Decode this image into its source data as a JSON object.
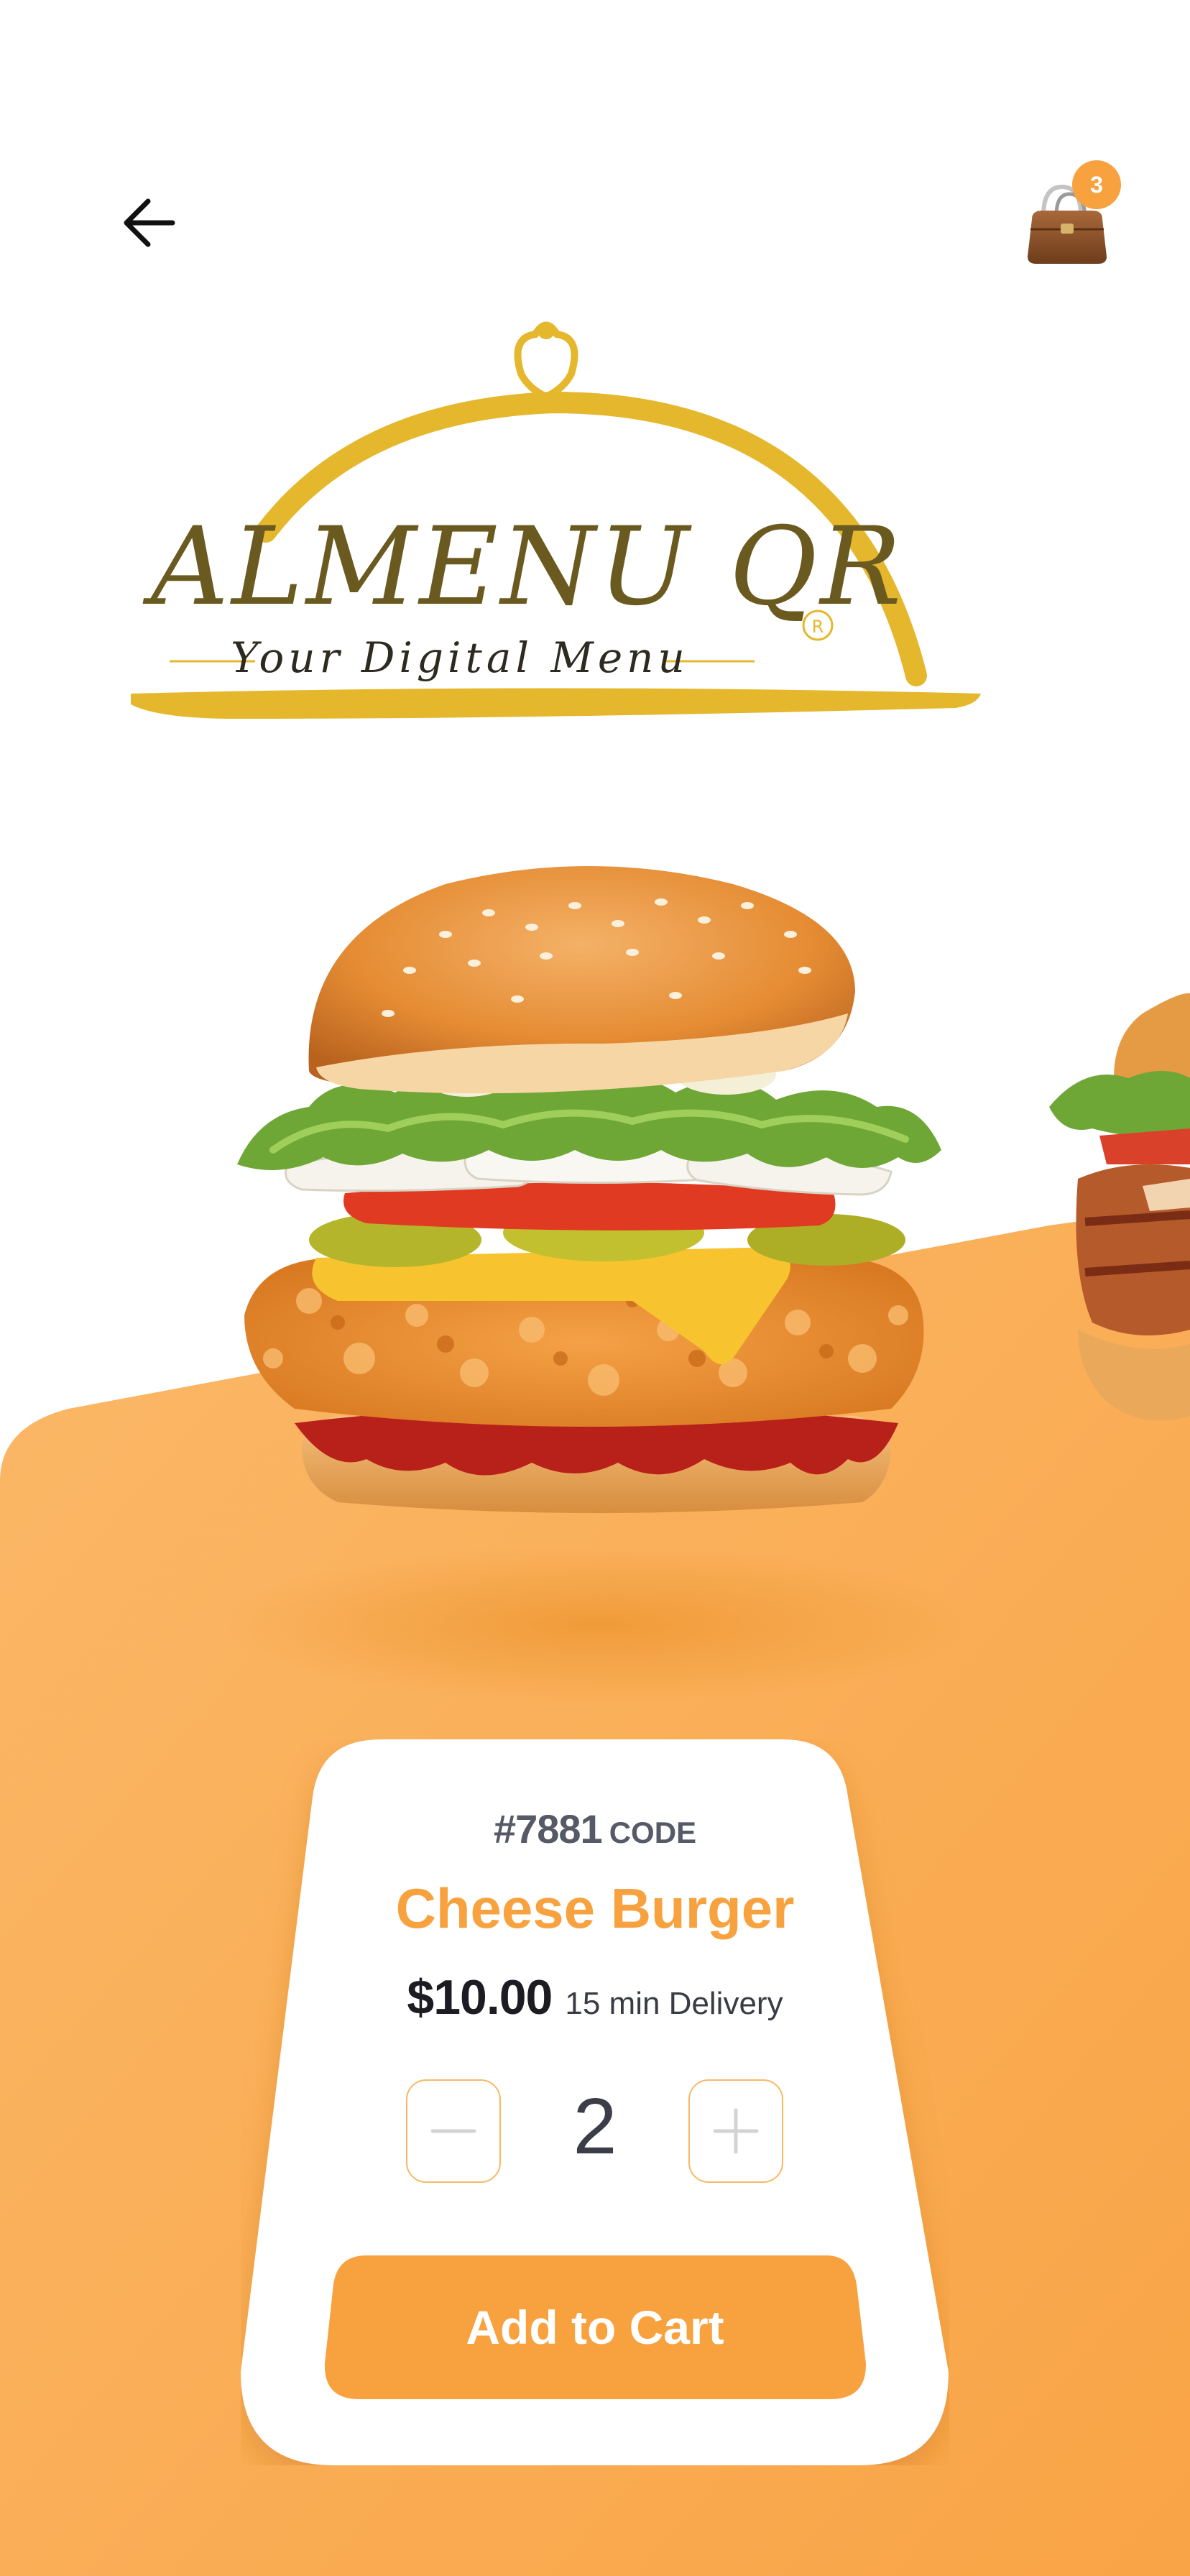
{
  "header": {
    "back_icon": "arrow-left-icon",
    "cart_icon": "shopping-bag-icon",
    "cart_count": "3"
  },
  "logo": {
    "brand": "ALMENU QR",
    "tagline": "Your Digital Menu",
    "registered": "R"
  },
  "product": {
    "code_number": "#7881",
    "code_label": "CODE",
    "name": "Cheese Burger",
    "price": "$10.00",
    "delivery": "15 min Delivery",
    "quantity": "2"
  },
  "actions": {
    "decrease_icon": "minus-icon",
    "increase_icon": "plus-icon",
    "add_to_cart": "Add to Cart"
  },
  "colors": {
    "accent": "#f7a23f",
    "logo_gold": "#e5b72d",
    "background": "#ffffff",
    "text_dark": "#1c1c22"
  }
}
